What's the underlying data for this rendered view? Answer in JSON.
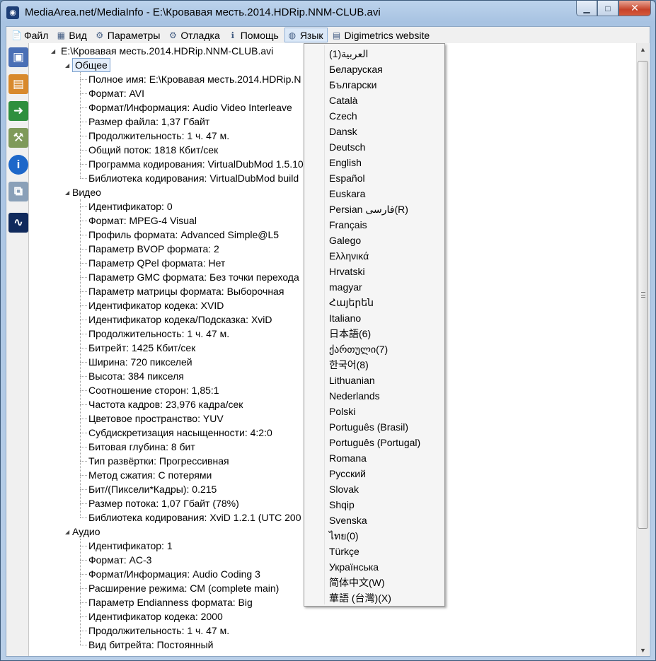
{
  "window": {
    "title": "MediaArea.net/MediaInfo - E:\\Кровавая месть.2014.HDRip.NNM-CLUB.avi",
    "min_glyph": "▁",
    "max_glyph": "□",
    "close_glyph": "✕"
  },
  "menu": [
    {
      "label": "Файл",
      "icon": "file-icon"
    },
    {
      "label": "Вид",
      "icon": "view-icon"
    },
    {
      "label": "Параметры",
      "icon": "settings-icon"
    },
    {
      "label": "Отладка",
      "icon": "debug-icon"
    },
    {
      "label": "Помощь",
      "icon": "help-icon"
    },
    {
      "label": "Язык",
      "icon": "globe-icon",
      "active": true
    },
    {
      "label": "Digimetrics website",
      "icon": "digimetrics-icon"
    }
  ],
  "toolbar": [
    "open-file-icon",
    "open-folder-icon",
    "export-icon",
    "preferences-icon",
    "info-icon",
    "copy-icon",
    "waveform-icon"
  ],
  "tree": {
    "root": "E:\\Кровавая месть.2014.HDRip.NNM-CLUB.avi",
    "sections": [
      {
        "name": "Общее",
        "selected": true,
        "items": [
          "Полное имя: E:\\Кровавая месть.2014.HDRip.N",
          "Формат: AVI",
          "Формат/Информация: Audio Video Interleave",
          "Размер файла: 1,37 Гбайт",
          "Продолжительность: 1 ч. 47 м.",
          "Общий поток: 1818 Кбит/сек",
          "Программа кодирования: VirtualDubMod 1.5.10",
          "Библиотека кодирования: VirtualDubMod build"
        ]
      },
      {
        "name": "Видео",
        "items": [
          "Идентификатор: 0",
          "Формат: MPEG-4 Visual",
          "Профиль формата: Advanced Simple@L5",
          "Параметр BVOP формата: 2",
          "Параметр QPel формата: Нет",
          "Параметр GMC формата: Без точки перехода",
          "Параметр матрицы формата: Выборочная",
          "Идентификатор кодека: XVID",
          "Идентификатор кодека/Подсказка: XviD",
          "Продолжительность: 1 ч. 47 м.",
          "Битрейт: 1425 Кбит/сек",
          "Ширина: 720 пикселей",
          "Высота: 384 пикселя",
          "Соотношение сторон: 1,85:1",
          "Частота кадров: 23,976 кадра/сек",
          "Цветовое пространство: YUV",
          "Субдискретизация насыщенности: 4:2:0",
          "Битовая глубина: 8 бит",
          "Тип развёртки: Прогрессивная",
          "Метод сжатия: С потерями",
          "Бит/(Пиксели*Кадры): 0.215",
          "Размер потока: 1,07 Гбайт (78%)",
          "Библиотека кодирования: XviD 1.2.1 (UTC 200"
        ]
      },
      {
        "name": "Аудио",
        "items": [
          "Идентификатор: 1",
          "Формат: AC-3",
          "Формат/Информация: Audio Coding 3",
          "Расширение режима: CM (complete main)",
          "Параметр Endianness формата: Big",
          "Идентификатор кодека: 2000",
          "Продолжительность: 1 ч. 47 м.",
          "Вид битрейта: Постоянный"
        ]
      }
    ]
  },
  "language_menu": [
    "(العربية(1",
    "Беларуская",
    "Български",
    "Català",
    "Czech",
    "Dansk",
    "Deutsch",
    "English",
    "Español",
    "Euskara",
    "Persian  فارسی(R)",
    "Français",
    "Galego",
    "Ελληνικά",
    "Hrvatski",
    "magyar",
    "Հայերեն",
    "Italiano",
    "日本語(6)",
    "ქართული(7)",
    "한국어(8)",
    "Lithuanian",
    "Nederlands",
    "Polski",
    "Português (Brasil)",
    "Português (Portugal)",
    "Romana",
    "Русский",
    "Slovak",
    "Shqip",
    "Svenska",
    "ไทย(0)",
    "Türkçe",
    "Українська",
    "简体中文(W)",
    "華語 (台灣)(X)"
  ],
  "colors": {
    "accent": "#1d3f77",
    "selection": "#e4eefb",
    "close_button": "#c6432a"
  }
}
